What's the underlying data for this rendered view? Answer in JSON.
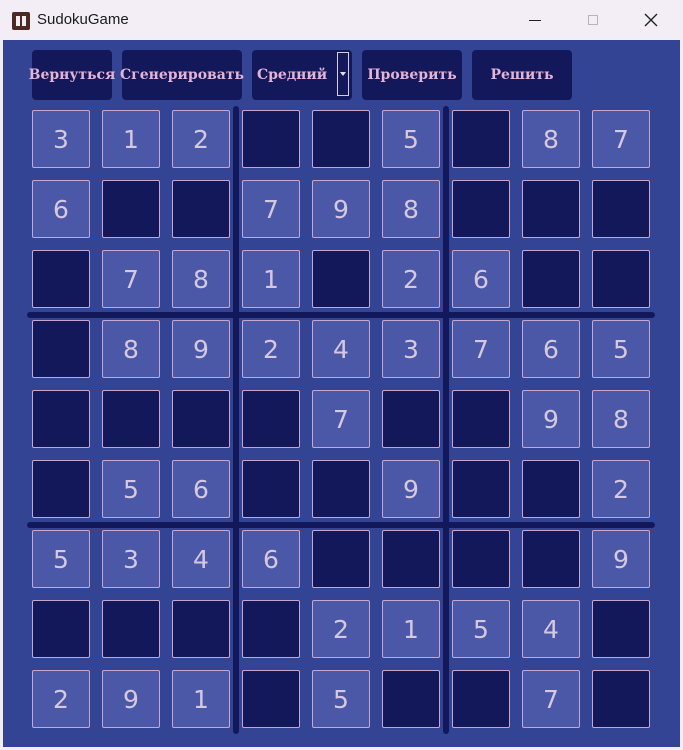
{
  "window": {
    "title": "SudokuGame",
    "icon": "sudoku-app-icon"
  },
  "toolbar": {
    "back_label": "Вернуться",
    "generate_label": "Сгенерировать",
    "difficulty_value": "Средний",
    "check_label": "Проверить",
    "solve_label": "Решить"
  },
  "colors": {
    "background": "#344494",
    "button": "#13185a",
    "button_text": "#e4b4d6",
    "filled_cell": "#4b58a8",
    "empty_cell": "#13185a",
    "cell_border": "#c7a6cf",
    "digit": "#d6c8de"
  },
  "board": [
    [
      "3",
      "1",
      "2",
      "",
      "",
      "5",
      "",
      "8",
      "7"
    ],
    [
      "6",
      "",
      "",
      "7",
      "9",
      "8",
      "",
      "",
      ""
    ],
    [
      "",
      "7",
      "8",
      "1",
      "",
      "2",
      "6",
      "",
      ""
    ],
    [
      "",
      "8",
      "9",
      "2",
      "4",
      "3",
      "7",
      "6",
      "5"
    ],
    [
      "",
      "",
      "",
      "",
      "7",
      "",
      "",
      "9",
      "8"
    ],
    [
      "",
      "5",
      "6",
      "",
      "",
      "9",
      "",
      "",
      "2"
    ],
    [
      "5",
      "3",
      "4",
      "6",
      "",
      "",
      "",
      "",
      "9"
    ],
    [
      "",
      "",
      "",
      "",
      "2",
      "1",
      "5",
      "4",
      ""
    ],
    [
      "2",
      "9",
      "1",
      "",
      "5",
      "",
      "",
      "7",
      ""
    ]
  ]
}
